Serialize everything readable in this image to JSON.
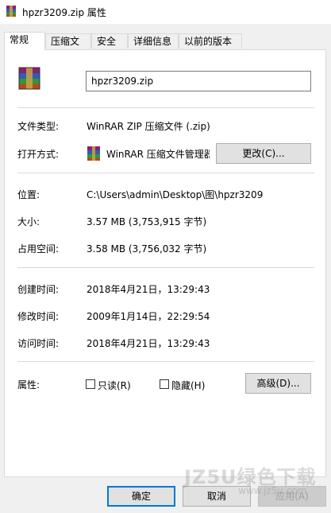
{
  "window": {
    "title": "hpzr3209.zip 属性",
    "icon": "winrar-archive-icon"
  },
  "tabs": [
    {
      "label": "常规",
      "active": true
    },
    {
      "label": "压缩文件",
      "active": false
    },
    {
      "label": "安全",
      "active": false
    },
    {
      "label": "详细信息",
      "active": false
    },
    {
      "label": "以前的版本",
      "active": false
    }
  ],
  "general": {
    "file_name": "hpzr3209.zip",
    "file_type_label": "文件类型:",
    "file_type_value": "WinRAR ZIP 压缩文件 (.zip)",
    "open_with_label": "打开方式:",
    "open_with_value": "WinRAR 压缩文件管理器",
    "change_button": "更改(C)...",
    "location_label": "位置:",
    "location_value": "C:\\Users\\admin\\Desktop\\图\\hpzr3209",
    "size_label": "大小:",
    "size_value": "3.57 MB (3,753,915 字节)",
    "disk_size_label": "占用空间:",
    "disk_size_value": "3.58 MB (3,756,032 字节)",
    "created_label": "创建时间:",
    "created_value": "2018年4月21日，13:29:43",
    "modified_label": "修改时间:",
    "modified_value": "2009年1月14日，22:29:54",
    "accessed_label": "访问时间:",
    "accessed_value": "2018年4月21日，13:29:43",
    "attributes_label": "属性:",
    "readonly_label": "只读(R)",
    "readonly_checked": false,
    "hidden_label": "隐藏(H)",
    "hidden_checked": false,
    "advanced_button": "高级(D)..."
  },
  "footer": {
    "ok": "确定",
    "cancel": "取消",
    "apply": "应用(A)"
  },
  "watermark": {
    "text": "JZ5U绿色下载",
    "url": "www.jz5u.com"
  }
}
